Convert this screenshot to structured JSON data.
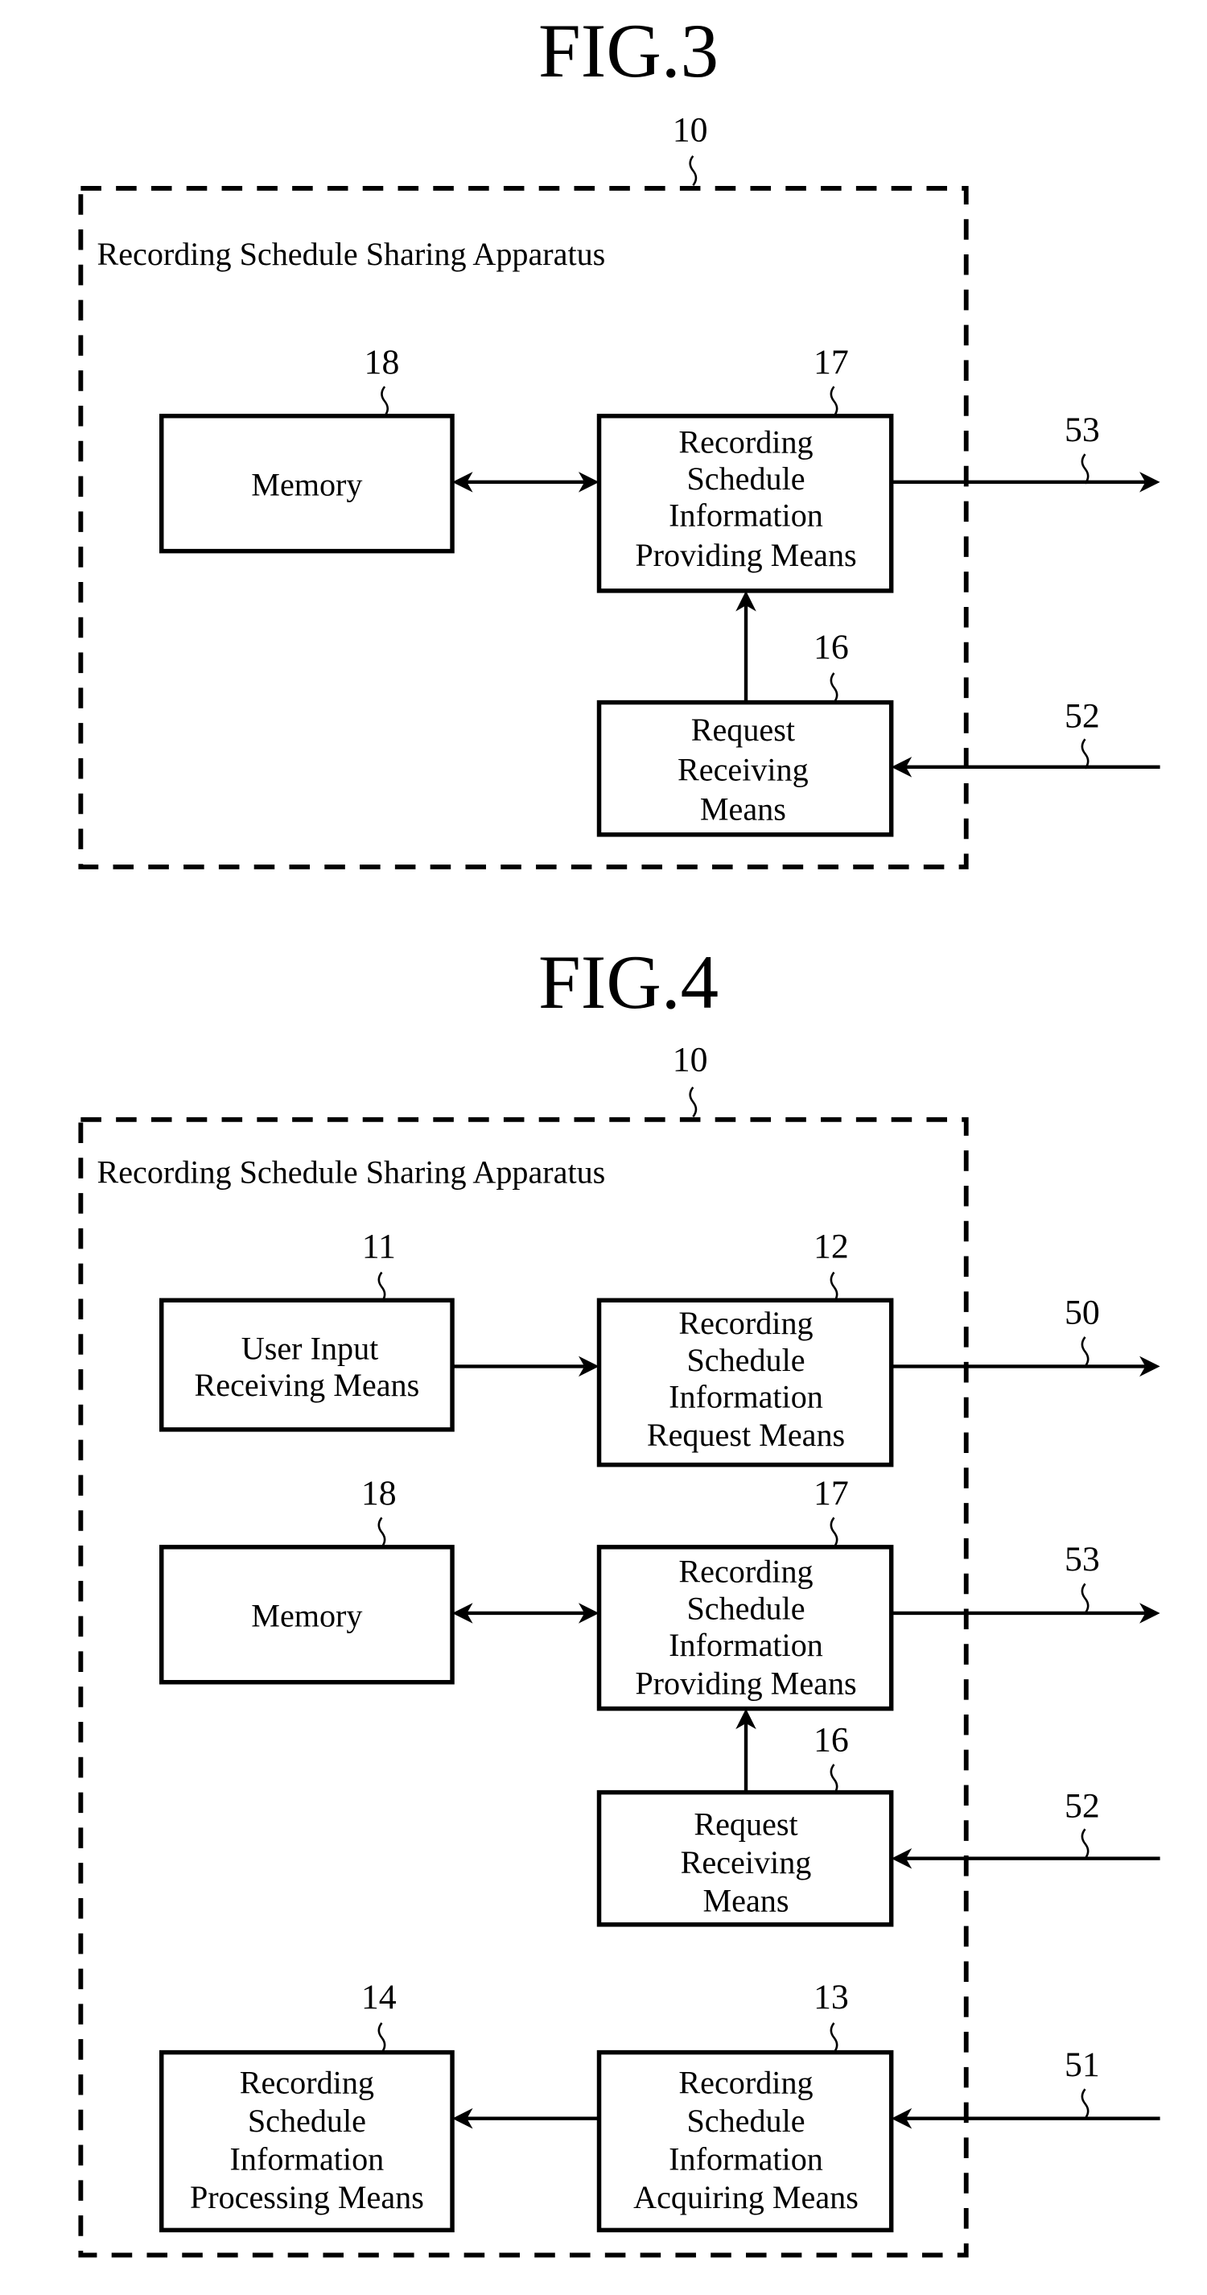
{
  "figures": [
    {
      "title": "FIG.3",
      "apparatus_ref": "10",
      "apparatus_label": "Recording Schedule Sharing Apparatus",
      "blocks": [
        {
          "id": "memory",
          "ref": "18",
          "lines": [
            "Memory"
          ]
        },
        {
          "id": "providing",
          "ref": "17",
          "lines": [
            "Recording",
            "Schedule",
            "Information",
            "Providing Means"
          ]
        },
        {
          "id": "request-receiving",
          "ref": "16",
          "lines": [
            "Request",
            "Receiving",
            "Means"
          ]
        }
      ],
      "signals": [
        {
          "ref": "53",
          "direction": "out",
          "from": "providing"
        },
        {
          "ref": "52",
          "direction": "in",
          "to": "request-receiving"
        }
      ],
      "connections": [
        {
          "from": "memory",
          "to": "providing",
          "bidirectional": true
        },
        {
          "from": "request-receiving",
          "to": "providing",
          "bidirectional": false
        }
      ]
    },
    {
      "title": "FIG.4",
      "apparatus_ref": "10",
      "apparatus_label": "Recording Schedule Sharing Apparatus",
      "blocks": [
        {
          "id": "user-input",
          "ref": "11",
          "lines": [
            "User Input",
            "Receiving Means"
          ]
        },
        {
          "id": "request-means",
          "ref": "12",
          "lines": [
            "Recording",
            "Schedule",
            "Information",
            "Request Means"
          ]
        },
        {
          "id": "memory",
          "ref": "18",
          "lines": [
            "Memory"
          ]
        },
        {
          "id": "providing",
          "ref": "17",
          "lines": [
            "Recording",
            "Schedule",
            "Information",
            "Providing Means"
          ]
        },
        {
          "id": "request-receiving",
          "ref": "16",
          "lines": [
            "Request",
            "Receiving",
            "Means"
          ]
        },
        {
          "id": "processing",
          "ref": "14",
          "lines": [
            "Recording",
            "Schedule",
            "Information",
            "Processing Means"
          ]
        },
        {
          "id": "acquiring",
          "ref": "13",
          "lines": [
            "Recording",
            "Schedule",
            "Information",
            "Acquiring Means"
          ]
        }
      ],
      "signals": [
        {
          "ref": "50",
          "direction": "out",
          "from": "request-means"
        },
        {
          "ref": "53",
          "direction": "out",
          "from": "providing"
        },
        {
          "ref": "52",
          "direction": "in",
          "to": "request-receiving"
        },
        {
          "ref": "51",
          "direction": "in",
          "to": "acquiring"
        }
      ],
      "connections": [
        {
          "from": "user-input",
          "to": "request-means",
          "bidirectional": false
        },
        {
          "from": "memory",
          "to": "providing",
          "bidirectional": true
        },
        {
          "from": "request-receiving",
          "to": "providing",
          "bidirectional": false
        },
        {
          "from": "acquiring",
          "to": "processing",
          "bidirectional": false
        }
      ]
    }
  ]
}
